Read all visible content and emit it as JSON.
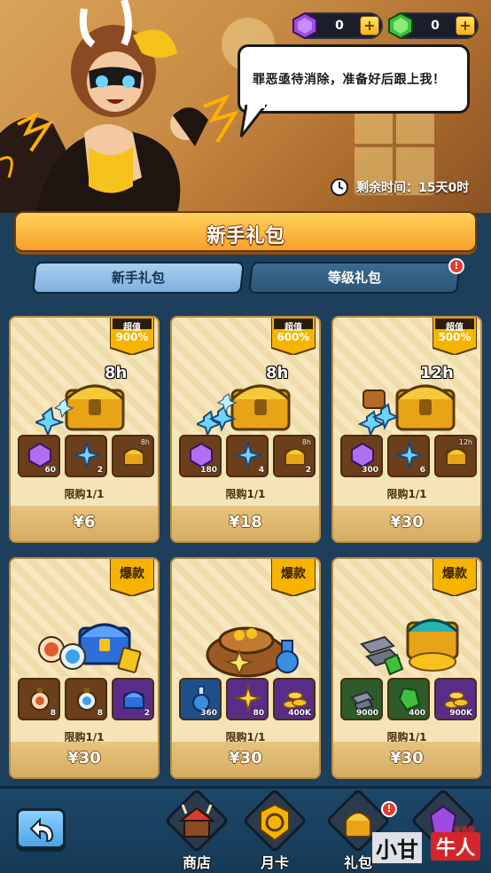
{
  "resources": {
    "purple_gem": {
      "count": "0",
      "plus": "+",
      "icon": "purple-gem-icon"
    },
    "green_gem": {
      "count": "0",
      "plus": "+",
      "icon": "green-gem-icon"
    }
  },
  "hero": {
    "speech": "罪恶亟待消除，准备好后跟上我！",
    "timer_label": "剩余时间：15天0时"
  },
  "title": "新手礼包",
  "tabs": [
    {
      "label": "新手礼包",
      "active": true
    },
    {
      "label": "等级礼包",
      "active": false,
      "alert": "!"
    }
  ],
  "cards": [
    {
      "badge_top": "超值",
      "badge_bottom": "900%",
      "hours": "8h",
      "limit": "限购1/1",
      "price": "¥6",
      "items": [
        {
          "icon": "purple-gem-icon",
          "qty": "60"
        },
        {
          "icon": "blue-shuriken-icon",
          "qty": "2"
        },
        {
          "icon": "gold-chest-icon",
          "qty": "",
          "tag": "8h"
        }
      ]
    },
    {
      "badge_top": "超值",
      "badge_bottom": "600%",
      "hours": "8h",
      "limit": "限购1/1",
      "price": "¥18",
      "items": [
        {
          "icon": "purple-gem-icon",
          "qty": "180"
        },
        {
          "icon": "blue-shuriken-icon",
          "qty": "4"
        },
        {
          "icon": "gold-chest-icon",
          "qty": "2",
          "tag": "8h"
        }
      ]
    },
    {
      "badge_top": "超值",
      "badge_bottom": "500%",
      "hours": "12h",
      "limit": "限购1/1",
      "price": "¥30",
      "items": [
        {
          "icon": "purple-gem-icon",
          "qty": "300"
        },
        {
          "icon": "blue-shuriken-icon",
          "qty": "6"
        },
        {
          "icon": "gold-chest-icon",
          "qty": "",
          "tag": "12h"
        }
      ]
    },
    {
      "badge_hot": "爆款",
      "limit": "限购1/1",
      "price": "¥30",
      "items": [
        {
          "icon": "red-potion-icon",
          "qty": "8"
        },
        {
          "icon": "blue-potion-icon",
          "qty": "8"
        },
        {
          "icon": "blue-chest-icon",
          "qty": "2"
        }
      ]
    },
    {
      "badge_hot": "爆款",
      "limit": "限购1/1",
      "price": "¥30",
      "items": [
        {
          "icon": "mana-flask-icon",
          "qty": "360"
        },
        {
          "icon": "gold-star-icon",
          "qty": "80"
        },
        {
          "icon": "gold-coins-icon",
          "qty": "400K"
        }
      ]
    },
    {
      "badge_hot": "爆款",
      "limit": "限购1/1",
      "price": "¥30",
      "items": [
        {
          "icon": "iron-ore-icon",
          "qty": "9000"
        },
        {
          "icon": "green-crystal-icon",
          "qty": "400"
        },
        {
          "icon": "gold-coins-icon",
          "qty": "900K"
        }
      ]
    }
  ],
  "nav": {
    "back": "back-arrow-icon",
    "items": [
      {
        "label": "商店",
        "icon": "shop-icon"
      },
      {
        "label": "月卡",
        "icon": "monthly-card-icon"
      },
      {
        "label": "礼包",
        "icon": "gift-chest-icon",
        "alert": "!"
      },
      {
        "label": "",
        "icon": "purple-crystal-icon"
      }
    ]
  },
  "watermark": {
    "text1": "小甘",
    "text2": "牛人",
    "tiny": "资源网"
  },
  "colors": {
    "accent_orange": "#f7a12b",
    "tab_active": "#8fc0e8",
    "card_bg": "#f4e4b8",
    "nav_bg": "#1d4768"
  }
}
